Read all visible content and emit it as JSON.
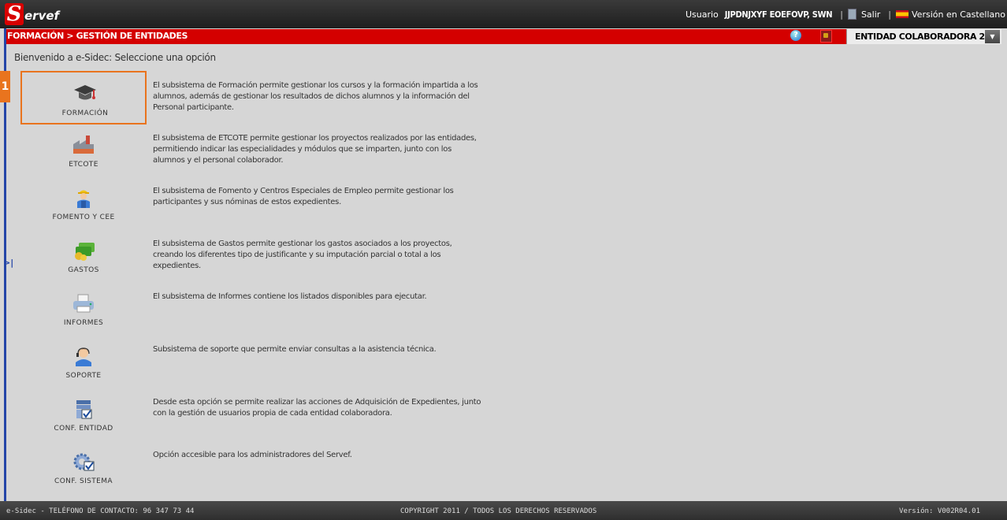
{
  "app": {
    "logo_initial": "S",
    "logo_rest": "ervef"
  },
  "userbar": {
    "label": "Usuario",
    "user_name": "JJPDNJXYF EOEFOVP, SWN",
    "separator": "|",
    "logout": "Salir",
    "language": "Versión en Castellano"
  },
  "crumbbar": {
    "breadcrumb": "FORMACIÓN > GESTIÓN DE ENTIDADES",
    "help_glyph": "?",
    "entity_selected": "ENTIDAD COLABORADORA 2",
    "dropdown_glyph": "▼"
  },
  "sidebar": {
    "expand_glyph": ">|"
  },
  "welcome": "Bienvenido a e-Sidec: Seleccione una opción",
  "marker_label": "1",
  "menu": [
    {
      "name": "FORMACIÓN",
      "icon": "graduation-cap-icon",
      "description": "El subsistema de Formación permite gestionar los cursos y la formación impartida a los alumnos, además de gestionar los resultados de dichos alumnos y la información del Personal participante."
    },
    {
      "name": "ETCOTE",
      "icon": "factory-icon",
      "description": "El subsistema de ETCOTE permite gestionar los proyectos realizados por las entidades, permitiendo indicar las especialidades y módulos que se imparten, junto con los alumnos y el personal colaborador."
    },
    {
      "name": "FOMENTO Y CEE",
      "icon": "worker-icon",
      "description": "El subsistema de Fomento y Centros Especiales de Empleo permite gestionar los participantes y sus nóminas de estos expedientes."
    },
    {
      "name": "GASTOS",
      "icon": "money-icon",
      "description": "El subsistema de Gastos permite gestionar los gastos asociados a los proyectos, creando los diferentes tipo de justificante y su imputación parcial o total a los expedientes."
    },
    {
      "name": "INFORMES",
      "icon": "printer-icon",
      "description": "El subsistema de Informes contiene los listados disponibles para ejecutar."
    },
    {
      "name": "SOPORTE",
      "icon": "support-agent-icon",
      "description": "Subsistema de soporte que permite enviar consultas a la asistencia técnica."
    },
    {
      "name": "CONF. ENTIDAD",
      "icon": "entity-config-icon",
      "description": "Desde esta opción se permite realizar las acciones de Adquisición de Expedientes, junto con la gestión de usuarios propia de cada entidad colaboradora."
    },
    {
      "name": "CONF. SISTEMA",
      "icon": "system-config-icon",
      "description": "Opción accesible para los administradores del Servef."
    }
  ],
  "footer": {
    "contact": "e-Sidec - TELÉFONO DE CONTACTO: 96 347 73 44",
    "copyright": "COPYRIGHT 2011 / TODOS LOS DERECHOS RESERVADOS",
    "version": "Versión: V002R04.01"
  },
  "colors": {
    "brand_red": "#d40000",
    "highlight_orange": "#e9741e",
    "accent_blue": "#2446a8"
  }
}
